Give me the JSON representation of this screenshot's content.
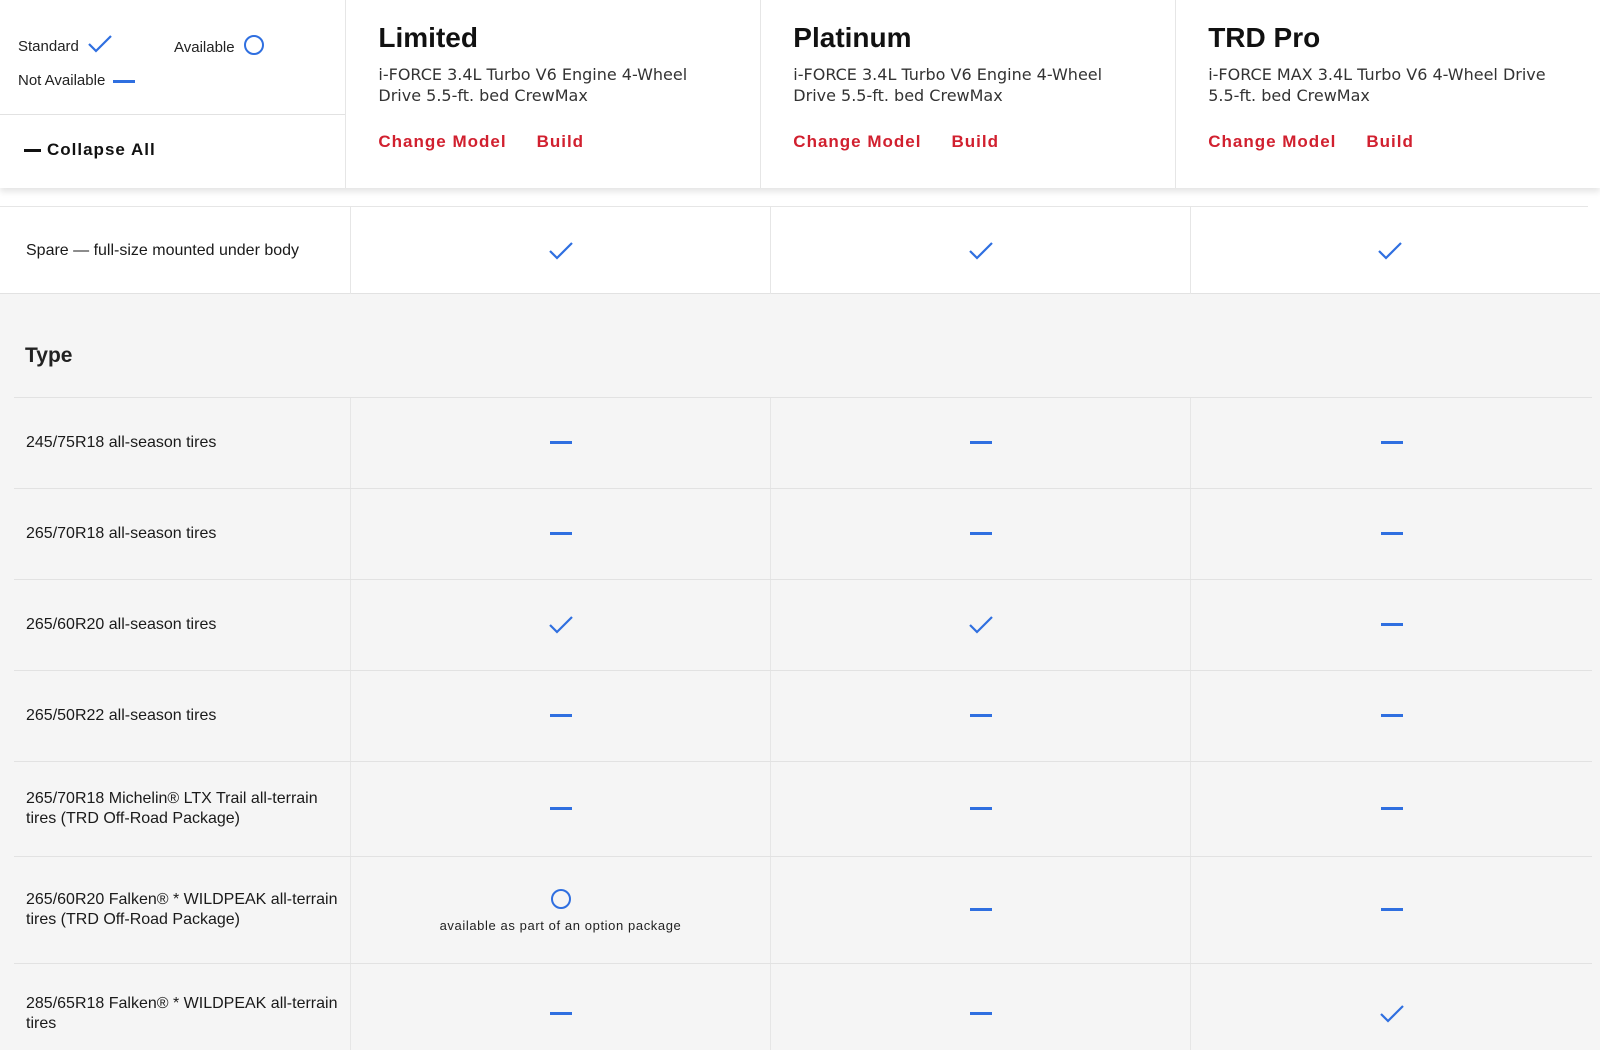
{
  "legend": {
    "standard_label": "Standard",
    "available_label": "Available",
    "not_available_label": "Not Available",
    "collapse_label": "Collapse All"
  },
  "models": [
    {
      "name": "Limited",
      "description": "i-FORCE 3.4L Turbo V6 Engine 4-Wheel Drive 5.5-ft. bed CrewMax",
      "change_label": "Change Model",
      "build_label": "Build"
    },
    {
      "name": "Platinum",
      "description": "i-FORCE 3.4L Turbo V6 Engine 4-Wheel Drive 5.5-ft. bed CrewMax",
      "change_label": "Change Model",
      "build_label": "Build"
    },
    {
      "name": "TRD Pro",
      "description": "i-FORCE MAX 3.4L Turbo V6 4-Wheel Drive 5.5-ft. bed CrewMax",
      "change_label": "Change Model",
      "build_label": "Build"
    }
  ],
  "spare": {
    "label": "Spare — full-size mounted under body",
    "values": [
      "standard",
      "standard",
      "standard"
    ]
  },
  "section": {
    "title": "Type",
    "rows": [
      {
        "label": "245/75R18 all-season tires",
        "values": [
          "na",
          "na",
          "na"
        ]
      },
      {
        "label": "265/70R18 all-season tires",
        "values": [
          "na",
          "na",
          "na"
        ]
      },
      {
        "label": "265/60R20 all-season tires",
        "values": [
          "standard",
          "standard",
          "na"
        ]
      },
      {
        "label": "265/50R22 all-season tires",
        "values": [
          "na",
          "na",
          "na"
        ]
      },
      {
        "label": "265/70R18 Michelin® LTX Trail all-terrain tires (TRD Off-Road Package)",
        "values": [
          "na",
          "na",
          "na"
        ]
      },
      {
        "label": "265/60R20 Falken® * WILDPEAK all-terrain tires (TRD Off-Road Package)",
        "values": [
          "available",
          "na",
          "na"
        ],
        "notes": [
          "available as part of an option package",
          "",
          ""
        ]
      },
      {
        "label": "285/65R18 Falken® * WILDPEAK all-terrain tires",
        "values": [
          "na",
          "na",
          "standard"
        ]
      }
    ]
  },
  "colors": {
    "accent_blue": "#2f6fe0",
    "brand_red": "#d1202f"
  }
}
